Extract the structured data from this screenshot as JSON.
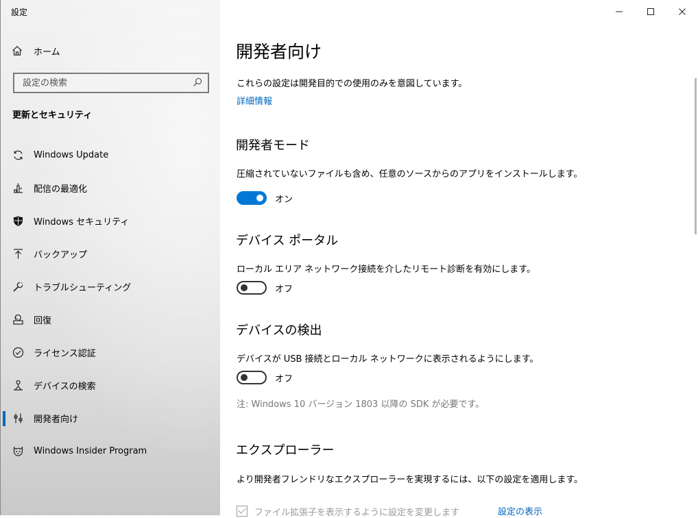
{
  "app": {
    "title": "設定"
  },
  "window_controls": {
    "minimize": "—",
    "maximize": "☐",
    "close": "✕"
  },
  "sidebar": {
    "home_label": "ホーム",
    "search_placeholder": "設定の検索",
    "section_heading": "更新とセキュリティ",
    "items": [
      {
        "label": "Windows Update",
        "icon": "sync-icon",
        "active": false
      },
      {
        "label": "配信の最適化",
        "icon": "delivery-optimization-icon",
        "active": false
      },
      {
        "label": "Windows セキュリティ",
        "icon": "shield-icon",
        "active": false
      },
      {
        "label": "バックアップ",
        "icon": "backup-icon",
        "active": false
      },
      {
        "label": "トラブルシューティング",
        "icon": "wrench-icon",
        "active": false
      },
      {
        "label": "回復",
        "icon": "recovery-icon",
        "active": false
      },
      {
        "label": "ライセンス認証",
        "icon": "check-circle-icon",
        "active": false
      },
      {
        "label": "デバイスの検索",
        "icon": "find-device-icon",
        "active": false
      },
      {
        "label": "開発者向け",
        "icon": "developer-tools-icon",
        "active": true
      },
      {
        "label": "Windows Insider Program",
        "icon": "insider-icon",
        "active": false
      }
    ]
  },
  "main": {
    "title": "開発者向け",
    "intro": "これらの設定は開発目的での使用のみを意図しています。",
    "more_info_link": "詳細情報",
    "developer_mode": {
      "heading": "開発者モード",
      "description": "圧縮されていないファイルも含め、任意のソースからのアプリをインストールします。",
      "state": "オン"
    },
    "device_portal": {
      "heading": "デバイス ポータル",
      "description": "ローカル エリア ネットワーク接続を介したリモート診断を有効にします。",
      "state": "オフ"
    },
    "device_discovery": {
      "heading": "デバイスの検出",
      "description": "デバイスが USB 接続とローカル ネットワークに表示されるようにします。",
      "state": "オフ",
      "note": "注: Windows 10 バージョン 1803 以降の SDK が必要です。"
    },
    "explorer": {
      "heading": "エクスプローラー",
      "description": "より開発者フレンドリなエクスプローラーを実現するには、以下の設定を適用します。",
      "checkbox_label": "ファイル拡張子を表示するように設定を変更します",
      "show_settings_link": "設定の表示"
    }
  },
  "colors": {
    "accent": "#0078d4",
    "link": "#0067c0"
  }
}
